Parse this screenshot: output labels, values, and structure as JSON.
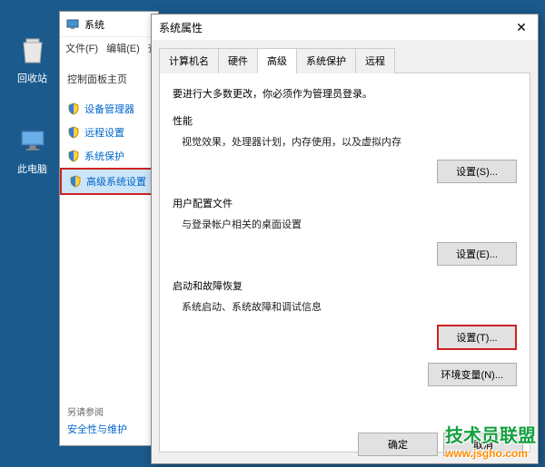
{
  "desktop": {
    "recycle_bin": "回收站",
    "this_pc": "此电脑"
  },
  "system_window": {
    "title": "系统",
    "menu": {
      "file": "文件(F)",
      "edit": "编辑(E)",
      "more": "查"
    },
    "cp_home": "控制面板主页",
    "nav": [
      {
        "label": "设备管理器"
      },
      {
        "label": "远程设置"
      },
      {
        "label": "系统保护"
      },
      {
        "label": "高级系统设置"
      }
    ],
    "see_also": "另请参阅",
    "see_also_link": "安全性与维护"
  },
  "dialog": {
    "title": "系统属性",
    "tabs": [
      "计算机名",
      "硬件",
      "高级",
      "系统保护",
      "远程"
    ],
    "admin_note": "要进行大多数更改，你必须作为管理员登录。",
    "sections": {
      "perf": {
        "title": "性能",
        "desc": "视觉效果，处理器计划，内存使用，以及虚拟内存",
        "btn": "设置(S)..."
      },
      "profile": {
        "title": "用户配置文件",
        "desc": "与登录帐户相关的桌面设置",
        "btn": "设置(E)..."
      },
      "startup": {
        "title": "启动和故障恢复",
        "desc": "系统启动、系统故障和调试信息",
        "btn": "设置(T)..."
      }
    },
    "env_btn": "环境变量(N)...",
    "ok": "确定",
    "cancel": "取消"
  },
  "watermark": {
    "line1": "技术员联盟",
    "line2": "www.jsgho.com"
  }
}
